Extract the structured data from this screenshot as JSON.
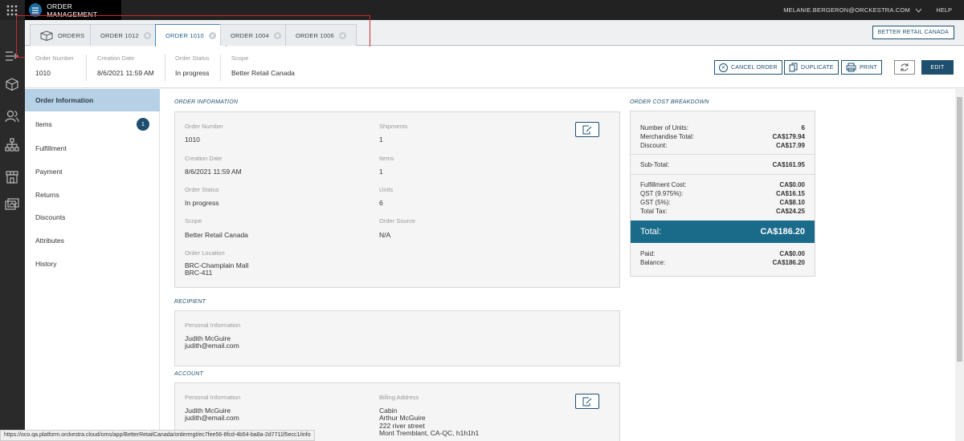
{
  "topbar": {
    "app_title": "ORDER MANAGEMENT",
    "user": "MELANIE.BERGERON@ORCKESTRA.COM",
    "help": "HELP"
  },
  "tabs": [
    {
      "label": "ORDERS"
    },
    {
      "label": "ORDER 1012"
    },
    {
      "label": "ORDER 1010"
    },
    {
      "label": "ORDER 1004"
    },
    {
      "label": "ORDER 1006"
    }
  ],
  "scope_button": "BETTER RETAIL CANADA",
  "summary": {
    "order_number": {
      "label": "Order Number",
      "value": "1010"
    },
    "creation_date": {
      "label": "Creation Date",
      "value": "8/6/2021 11:59 AM"
    },
    "order_status": {
      "label": "Order Status",
      "value": "In progress"
    },
    "scope": {
      "label": "Scope",
      "value": "Better Retail Canada"
    }
  },
  "actions": {
    "cancel": "CANCEL ORDER",
    "duplicate": "DUPLICATE",
    "print": "PRINT",
    "edit": "EDIT"
  },
  "sidenav": [
    {
      "label": "Order Information"
    },
    {
      "label": "Items",
      "badge": "1"
    },
    {
      "label": "Fulfillment"
    },
    {
      "label": "Payment"
    },
    {
      "label": "Returns"
    },
    {
      "label": "Discounts"
    },
    {
      "label": "Attributes"
    },
    {
      "label": "History"
    }
  ],
  "order_info": {
    "title": "ORDER INFORMATION",
    "order_number": {
      "label": "Order Number",
      "value": "1010"
    },
    "shipments": {
      "label": "Shipments",
      "value": "1"
    },
    "creation_date": {
      "label": "Creation Date",
      "value": "8/6/2021 11:59 AM"
    },
    "items": {
      "label": "Items",
      "value": "1"
    },
    "order_status": {
      "label": "Order Status",
      "value": "In progress"
    },
    "units": {
      "label": "Units",
      "value": "6"
    },
    "scope": {
      "label": "Scope",
      "value": "Better Retail Canada"
    },
    "order_source": {
      "label": "Order Source",
      "value": "N/A"
    },
    "order_location": {
      "label": "Order Location",
      "line1": "BRC-Champlain Mall",
      "line2": "BRC-411"
    }
  },
  "recipient": {
    "title": "RECIPIENT",
    "personal_label": "Personal Information",
    "name": "Judith McGuire",
    "email": "judith@email.com"
  },
  "account": {
    "title": "ACCOUNT",
    "personal_label": "Personal Information",
    "name": "Judith McGuire",
    "email": "judith@email.com",
    "billing_label": "Billing Address",
    "billing_line1": "Cabin",
    "billing_line2": "Arthur McGuire",
    "billing_line3": "222 river street",
    "billing_line4": "Mont Tremblant, CA-QC, h1h1h1"
  },
  "cost": {
    "title": "ORDER COST BREAKDOWN",
    "units": {
      "label": "Number of Units:",
      "value": "6"
    },
    "merch": {
      "label": "Merchandise Total:",
      "value": "CA$179.94"
    },
    "discount": {
      "label": "Discount:",
      "value": "CA$17.99"
    },
    "subtotal": {
      "label": "Sub-Total:",
      "value": "CA$161.95"
    },
    "fulfillment": {
      "label": "Fulfillment Cost:",
      "value": "CA$0.00"
    },
    "qst": {
      "label": "QST (9.975%):",
      "value": "CA$16.15"
    },
    "gst": {
      "label": "GST (5%):",
      "value": "CA$8.10"
    },
    "total_tax": {
      "label": "Total Tax:",
      "value": "CA$24.25"
    },
    "total": {
      "label": "Total:",
      "value": "CA$186.20"
    },
    "paid": {
      "label": "Paid:",
      "value": "CA$0.00"
    },
    "balance": {
      "label": "Balance:",
      "value": "CA$186.20"
    }
  },
  "status_url": "https://oco.qa.platform.orckestra.cloud/oms/app/BetterRetailCanada/ordermgt/ec7fee56-8fcd-4b54-ba8a-2d7711f5ecc1/info",
  "colors": {
    "accent": "#1e4f6e",
    "total_bar": "#1a6a8a",
    "nav_active": "#b6d0e6",
    "highlight": "#d0262d"
  }
}
